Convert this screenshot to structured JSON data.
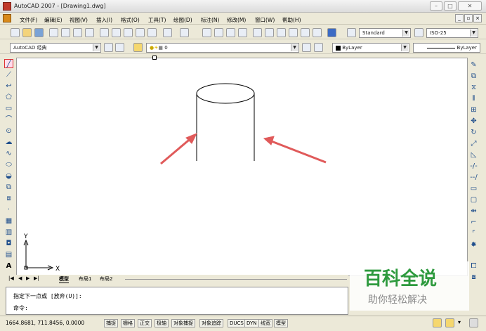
{
  "window": {
    "title": "AutoCAD 2007 - [Drawing1.dwg]"
  },
  "menu": [
    "文件(F)",
    "编辑(E)",
    "视图(V)",
    "插入(I)",
    "格式(O)",
    "工具(T)",
    "绘图(D)",
    "标注(N)",
    "修改(M)",
    "窗口(W)",
    "帮助(H)"
  ],
  "toolbar": {
    "text_style": "Standard",
    "dim_style": "ISO-25",
    "workspace": "AutoCAD 经典",
    "layer": "0",
    "color": "ByLayer",
    "linetype": "ByLayer"
  },
  "tabs": [
    "模型",
    "布局1",
    "布局2"
  ],
  "command": {
    "line1": "指定下一点或 [放弃(U)]:",
    "line2": "命令:"
  },
  "status": {
    "coords": "1664.8681, 711.8456, 0.0000",
    "buttons": [
      "捕捉",
      "栅格",
      "正交",
      "极轴",
      "对象捕捉",
      "对象追踪",
      "DUCS",
      "DYN",
      "线宽",
      "模型"
    ]
  },
  "ucs": {
    "x": "X",
    "y": "Y"
  },
  "watermark": {
    "title": "百科全说",
    "subtitle": "助你轻松解决"
  },
  "colors": {
    "arrow": "#e05a5a",
    "watermark_green": "#2e9a3e"
  }
}
